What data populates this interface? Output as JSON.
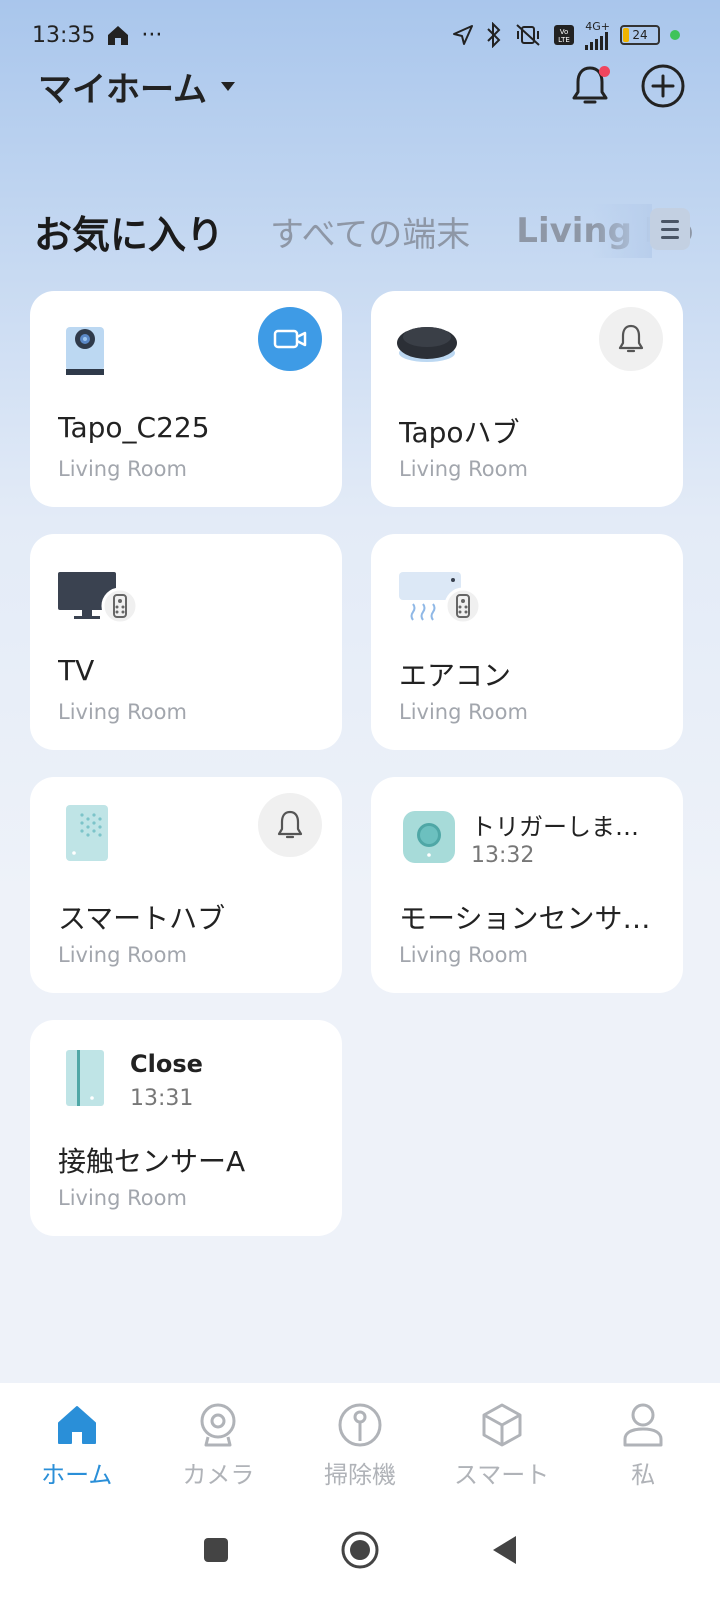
{
  "status_bar": {
    "time": "13:35",
    "more": "···",
    "network": "4G+",
    "battery": "24"
  },
  "header": {
    "home_name": "マイホーム"
  },
  "tabs": [
    {
      "label": "お気に入り"
    },
    {
      "label": "すべての端末"
    },
    {
      "label": "Living Room"
    }
  ],
  "devices": [
    {
      "name": "Tapo_C225",
      "room": "Living Room",
      "icon": "camera-device-icon",
      "action": "video-icon"
    },
    {
      "name": "Tapoハブ",
      "room": "Living Room",
      "icon": "hub-device-icon",
      "action": "bell-icon"
    },
    {
      "name": "TV",
      "room": "Living Room",
      "icon": "tv-device-icon"
    },
    {
      "name": "エアコン",
      "room": "Living Room",
      "icon": "aircon-device-icon"
    },
    {
      "name": "スマートハブ",
      "room": "Living Room",
      "icon": "smart-hub-device-icon",
      "action": "bell-icon"
    },
    {
      "name": "モーションセンサ…",
      "room": "Living Room",
      "icon": "motion-sensor-icon",
      "status": "トリガーしま…",
      "time": "13:32"
    },
    {
      "name": "接触センサーA",
      "room": "Living Room",
      "icon": "contact-sensor-icon",
      "status": "Close",
      "time": "13:31"
    }
  ],
  "bottom_nav": [
    {
      "label": "ホーム",
      "icon": "home-icon",
      "active": true
    },
    {
      "label": "カメラ",
      "icon": "camera-icon"
    },
    {
      "label": "掃除機",
      "icon": "vacuum-icon"
    },
    {
      "label": "スマート",
      "icon": "cube-icon"
    },
    {
      "label": "私",
      "icon": "person-icon"
    }
  ],
  "colors": {
    "accent": "#2a8fd8",
    "camera_action": "#3e9be6",
    "notification": "#f0455e"
  }
}
